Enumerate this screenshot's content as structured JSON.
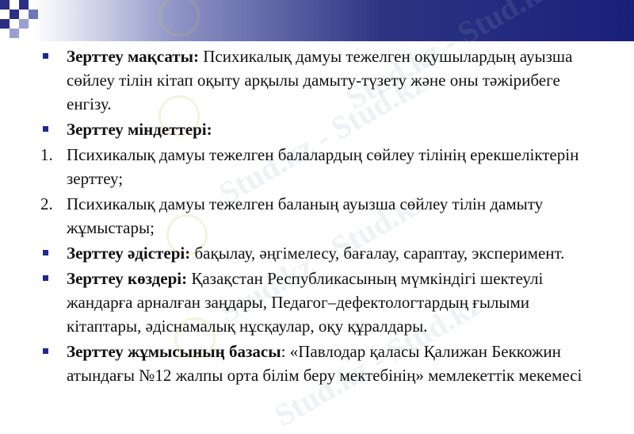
{
  "watermark": "Stud.kz - Stud.kz",
  "items": [
    {
      "type": "bullet",
      "label": "Зерттеу мақсаты:",
      "text": " Психикалық дамуы тежелген оқушылардың ауызша сөйлеу тілін кітап оқыту арқылы дамыту-түзету және оны тәжірибеге енгізу."
    },
    {
      "type": "bullet",
      "label": "Зерттеу міндеттері:",
      "text": ""
    },
    {
      "type": "number",
      "label": "1.",
      "text": "Психикалық дамуы тежелген балалардың сөйлеу тілінің ерекшеліктерін зерттеу;"
    },
    {
      "type": "number",
      "label": "2.",
      "text": "Психикалық дамуы тежелген баланың ауызша сөйлеу тілін дамыту жұмыстары;"
    },
    {
      "type": "bullet",
      "label": "Зерттеу әдістері:",
      "text": " бақылау, әңгімелесу, бағалау, сараптау, эксперимент."
    },
    {
      "type": "bullet",
      "label": "Зерттеу көздері:",
      "text": " Қазақстан Республикасының мүмкіндігі шектеулі жандарға арналған заңдары, Педагог–дефектологтардың ғылыми кітаптары, әдіснамалық нұсқаулар, оқу құралдары."
    },
    {
      "type": "bullet",
      "label": "Зерттеу жұмысының базасы",
      "text": ": «Павлодар қаласы Қалижан Беккожин атындағы №12 жалпы орта білім беру мектебінің» мемлекеттік мекемесі"
    }
  ]
}
